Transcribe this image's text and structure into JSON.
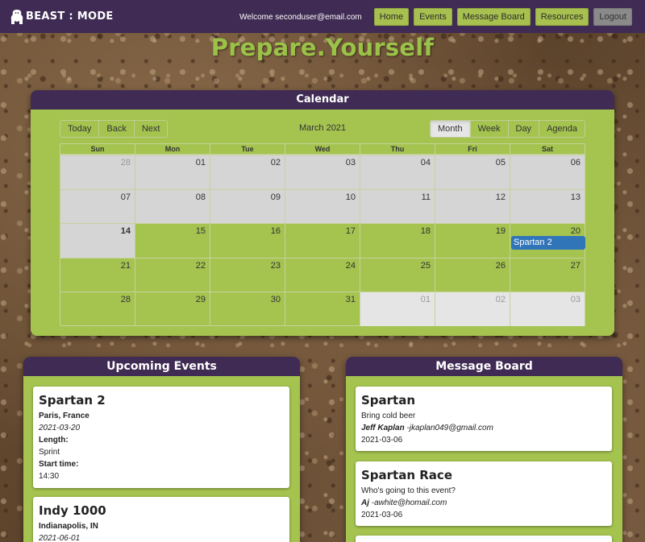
{
  "navbar": {
    "brand": "BEAST : MODE",
    "brand_icon": "gorilla-icon",
    "welcome": "Welcome seconduser@email.com",
    "links": [
      {
        "label": "Home"
      },
      {
        "label": "Events"
      },
      {
        "label": "Message Board"
      },
      {
        "label": "Resources"
      },
      {
        "label": "Logout"
      }
    ]
  },
  "page_title": "Prepare.Yourself",
  "calendar": {
    "header": "Calendar",
    "nav_buttons": [
      "Today",
      "Back",
      "Next"
    ],
    "label": "March 2021",
    "view_buttons": [
      "Month",
      "Week",
      "Day",
      "Agenda"
    ],
    "active_view": "Month",
    "weekdays": [
      "Sun",
      "Mon",
      "Tue",
      "Wed",
      "Thu",
      "Fri",
      "Sat"
    ],
    "weeks": [
      [
        "28",
        "01",
        "02",
        "03",
        "04",
        "05",
        "06"
      ],
      [
        "07",
        "08",
        "09",
        "10",
        "11",
        "12",
        "13"
      ],
      [
        "14",
        "15",
        "16",
        "17",
        "18",
        "19",
        "20"
      ],
      [
        "21",
        "22",
        "23",
        "24",
        "25",
        "26",
        "27"
      ],
      [
        "28",
        "29",
        "30",
        "31",
        "01",
        "02",
        "03"
      ]
    ],
    "event": {
      "title": "Spartan 2",
      "date": "20"
    }
  },
  "upcoming_events": {
    "header": "Upcoming Events",
    "items": [
      {
        "name": "Spartan 2",
        "location": "Paris, France",
        "date": "2021-03-20",
        "length_label": "Length:",
        "length": "Sprint",
        "start_label": "Start time:",
        "start": "14:30"
      },
      {
        "name": "Indy 1000",
        "location": "Indianapolis, IN",
        "date": "2021-06-01"
      }
    ]
  },
  "message_board": {
    "header": "Message Board",
    "posts": [
      {
        "title": "Spartan",
        "body": "Bring cold beer",
        "author": "Jeff Kaplan",
        "email": " -jkaplan049@gmail.com",
        "date": "2021-03-06"
      },
      {
        "title": "Spartan Race",
        "body": "Who's going to this event?",
        "author": "Aj",
        "email": " -awhite@homail.com",
        "date": "2021-03-06"
      }
    ]
  },
  "colors": {
    "nav_bg": "#3f2b53",
    "accent_green": "#a4c34f",
    "title_green": "#9bc248",
    "event_blue": "#3175b9"
  }
}
